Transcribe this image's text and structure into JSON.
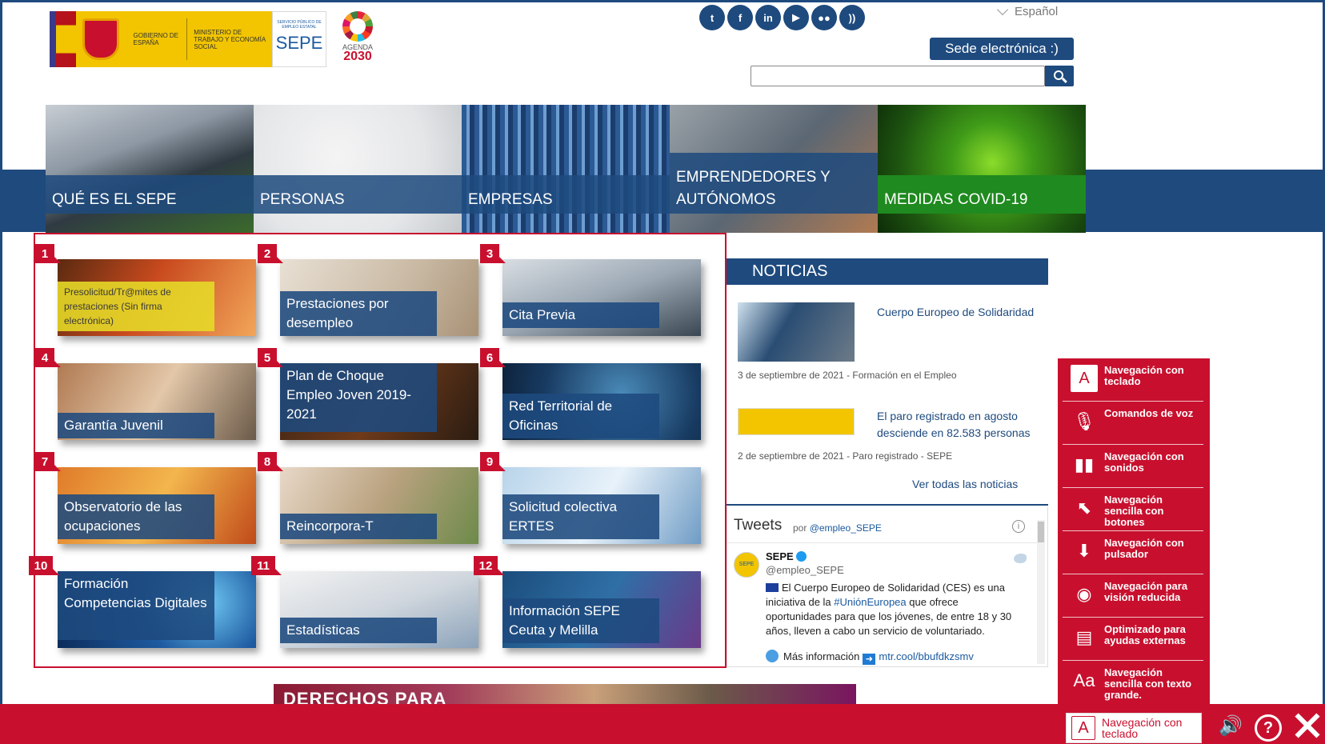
{
  "header": {
    "logo_gobierno": "GOBIERNO DE ESPAÑA",
    "logo_ministerio": "MINISTERIO DE TRABAJO Y ECONOMÍA SOCIAL",
    "logo_sepe_small": "SERVICIO PÚBLICO DE EMPLEO ESTATAL",
    "logo_sepe": "SEPE",
    "agenda_line1": "AGENDA",
    "agenda_line2": "2030",
    "social": [
      {
        "icon": "twitter-icon",
        "glyph": "t"
      },
      {
        "icon": "facebook-icon",
        "glyph": "f"
      },
      {
        "icon": "linkedin-icon",
        "glyph": "in"
      },
      {
        "icon": "youtube-icon",
        "glyph": "▶"
      },
      {
        "icon": "flickr-icon",
        "glyph": "●●"
      },
      {
        "icon": "rss-icon",
        "glyph": "))"
      }
    ],
    "language": "Español",
    "sede_button": "Sede electrónica :)",
    "search_value": ""
  },
  "nav": [
    {
      "label": "QUÉ ES EL SEPE"
    },
    {
      "label": "PERSONAS"
    },
    {
      "label": "EMPRESAS"
    },
    {
      "label": "EMPRENDEDORES Y AUTÓNOMOS"
    },
    {
      "label": "MEDIDAS COVID-19"
    }
  ],
  "services": [
    {
      "num": "1",
      "label": "Presolicitud/Tr@mites de prestaciones (Sin firma electrónica)"
    },
    {
      "num": "2",
      "label": "Prestaciones por desempleo"
    },
    {
      "num": "3",
      "label": "Cita Previa"
    },
    {
      "num": "4",
      "label": "Garantía Juvenil"
    },
    {
      "num": "5",
      "label": "Plan de Choque Empleo Joven 2019-2021"
    },
    {
      "num": "6",
      "label": "Red Territorial de Oficinas"
    },
    {
      "num": "7",
      "label": "Observatorio de las ocupaciones"
    },
    {
      "num": "8",
      "label": "Reincorpora-T"
    },
    {
      "num": "9",
      "label": "Solicitud colectiva ERTES"
    },
    {
      "num": "10",
      "label": "Formación Competencias Digitales"
    },
    {
      "num": "11",
      "label": "Estadísticas"
    },
    {
      "num": "12",
      "label": "Información SEPE Ceuta y Melilla"
    }
  ],
  "news": {
    "title": "NOTICIAS",
    "items": [
      {
        "title": "Cuerpo Europeo de Solidaridad",
        "meta": "3 de septiembre de 2021 - Formación en el Empleo"
      },
      {
        "title": "El paro registrado en agosto desciende en 82.583 personas",
        "meta": "2 de septiembre de 2021 - Paro registrado - SEPE"
      }
    ],
    "see_all": "Ver todas las noticias"
  },
  "tweets": {
    "title": "Tweets",
    "by": "por",
    "by_handle": "@empleo_SEPE",
    "info": "i",
    "author_name": "SEPE",
    "author_handle": "@empleo_SEPE",
    "avatar_text": "SEPE",
    "text_1": "El Cuerpo Europeo de Solidaridad (CES) es una iniciativa de la",
    "hashtag": "#UniónEuropea",
    "text_2": "que ofrece oportunidades para que los jóvenes, de entre 18 y 30 años, lleven a cabo un servicio de voluntariado.",
    "more_text": "Más información",
    "more_link": "mtr.cool/bbufdkzsmv"
  },
  "banner": {
    "text": "DERECHOS PARA"
  },
  "accessibility": {
    "items": [
      {
        "icon": "keyboard-a-icon",
        "glyph": "A",
        "label": "Navegación con teclado"
      },
      {
        "icon": "microphone-icon",
        "glyph": "🎙",
        "label": "Comandos de voz"
      },
      {
        "icon": "sound-bars-icon",
        "glyph": "▮▮",
        "label": "Navegación con sonidos"
      },
      {
        "icon": "cursor-click-icon",
        "glyph": "⬉",
        "label": "Navegación sencilla con botones"
      },
      {
        "icon": "switch-icon",
        "glyph": "⬇",
        "label": "Navegación con pulsador"
      },
      {
        "icon": "eye-icon",
        "glyph": "◉",
        "label": "Navegación para visión reducida"
      },
      {
        "icon": "external-aid-icon",
        "glyph": "▤",
        "label": "Optimizado para ayudas externas"
      },
      {
        "icon": "large-text-icon",
        "glyph": "Aa",
        "label": "Navegación sencilla con texto grande."
      }
    ],
    "selected": {
      "glyph": "A",
      "label": "Navegación con teclado"
    },
    "sound_glyph": "🔊",
    "help_glyph": "?"
  }
}
